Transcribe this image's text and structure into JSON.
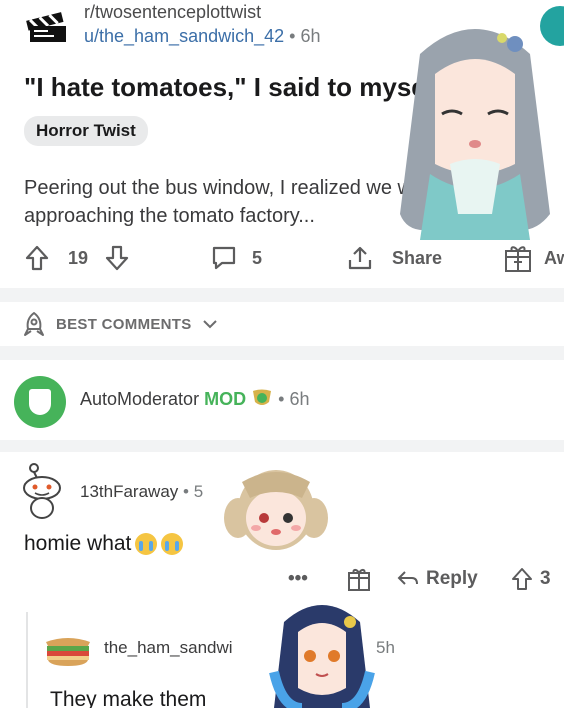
{
  "post": {
    "subreddit": "r/twosentenceplottwist",
    "author": "u/the_ham_sandwich_42",
    "age": "6h",
    "title": "\"I hate tomatoes,\" I said to myself.",
    "flair": "Horror Twist",
    "body": "Peering out the bus window, I realized we were approaching the tomato factory...",
    "upvotes": "19",
    "comments": "5",
    "share_label": "Share",
    "award_label": "Aw"
  },
  "sort": {
    "label": "BEST COMMENTS"
  },
  "comments": [
    {
      "author": "AutoModerator",
      "mod_tag": "MOD",
      "age": "6h"
    },
    {
      "author": "13thFaraway",
      "age": "5",
      "body": "homie what",
      "reply_label": "Reply",
      "votes": "3",
      "more": "•••"
    },
    {
      "author": "the_ham_sandwi",
      "age": "5h",
      "body": "They make them"
    }
  ],
  "colors": {
    "accent": "#46b35a",
    "link": "#3c6fa8",
    "teal": "#23a3a0"
  }
}
